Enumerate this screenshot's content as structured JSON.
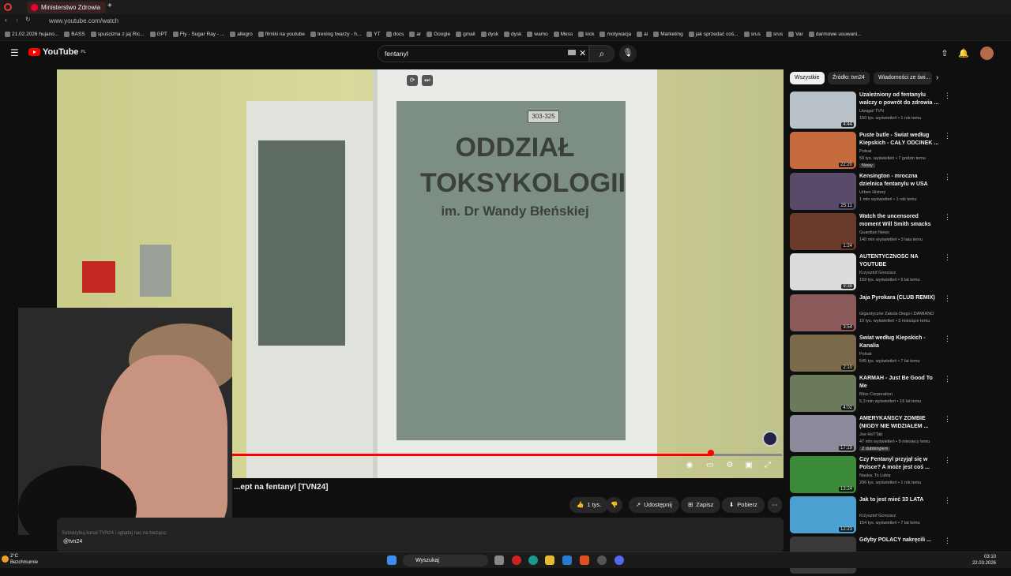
{
  "browser": {
    "tab_title": "Ministerstwo Zdrowia",
    "url": "www.youtube.com/watch"
  },
  "bookmarks": [
    "21.02.2026 hujano...",
    "BASS",
    "spuścizna z jaj Ric...",
    "GPT",
    "Fly - Sugar Ray - ...",
    "allegro",
    "filmiki na youtube",
    "trening twarzy - h...",
    "YT",
    "docs",
    "ar",
    "Google",
    "gmail",
    "dysk",
    "dysk",
    "wamo",
    "Mess",
    "kick",
    "motywacja",
    "ai",
    "Marketing",
    "jak sprzedać coś...",
    "srus",
    "srus",
    "Var",
    "darmowe usuwani..."
  ],
  "header": {
    "logo": "YouTube",
    "region": "PL",
    "search_value": "fentanyl"
  },
  "video": {
    "sign_room": "303-325",
    "sign_line1": "ODDZIAŁ",
    "sign_line2": "TOKSYKOLOGII",
    "sign_line3": "im. Dr Wandy Błeńskiej",
    "progress": 0.87,
    "title": "...ept na fentanyl [TVN24]"
  },
  "actions": {
    "likes": "1 tys.",
    "share": "Udostępnij",
    "save": "Zapisz",
    "download": "Pobierz"
  },
  "description": {
    "note": "Subskrybuj kanał TVN24 i oglądaj nas na bieżąco:",
    "channel": "@tvn24"
  },
  "chips": [
    "Wszystkie",
    "Źródło: tvn24",
    "Wiadomości ze świ..."
  ],
  "recommendations": [
    {
      "title": "Uzależniony od fentanylu walczy o powrót do zdrowia ...",
      "channel": "Uwaga! TVN",
      "meta": "150 tys. wyświetleń • 1 rok temu",
      "duration": "4:44",
      "color": "#b9c2c8",
      "badge": ""
    },
    {
      "title": "Puste butle - Świat według Kiepskich - CAŁY ODCINEK ...",
      "channel": "Polsat",
      "meta": "59 tys. wyświetleń • 7 godzin temu",
      "duration": "22:20",
      "color": "#c46a3c",
      "badge": "Nowy"
    },
    {
      "title": "Kensington - mroczna dzielnica fentanylu w USA",
      "channel": "Urbex History",
      "meta": "1 mln wyświetleń • 1 rok temu",
      "duration": "25:11",
      "color": "#5a4a6a",
      "badge": ""
    },
    {
      "title": "Watch the uncensored moment Will Smith smacks Chris Rock ...",
      "channel": "Guardian News",
      "meta": "140 mln wyświetleń • 3 lata temu",
      "duration": "1:24",
      "color": "#6a3a2a",
      "badge": ""
    },
    {
      "title": "AUTENTYCZNOŚĆ NA YOUTUBE",
      "channel": "Krzysztof Gonciarz",
      "meta": "159 tys. wyświetleń • 9 lat temu",
      "duration": "9:38",
      "color": "#dcdcdc",
      "badge": ""
    },
    {
      "title": "Jaja Pyrokara (CLUB REMIX)",
      "channel": "Gigantyczne Zakola Diego i DAMIANO",
      "meta": "10 tys. wyświetleń • 3 miesiące temu",
      "duration": "3:54",
      "color": "#8a5a5a",
      "badge": ""
    },
    {
      "title": "Świat według Kiepskich - Kanalia",
      "channel": "Polsat",
      "meta": "545 tys. wyświetleń • 7 lat temu",
      "duration": "2:10",
      "color": "#7a6a4a",
      "badge": ""
    },
    {
      "title": "KARMAH - Just Be Good To Me",
      "channel": "Bliss Corporation",
      "meta": "5,3 mln wyświetleń • 16 lat temu",
      "duration": "4:02",
      "color": "#6a7a5a",
      "badge": ""
    },
    {
      "title": "AMERYKAŃSCY ZOMBIE (NIGDY NIE WIDZIAŁEM ...",
      "channel": "Joe HsTTab",
      "meta": "47 mln wyświetleń • 9 miesięcy temu",
      "duration": "17:19",
      "color": "#8a8a9a",
      "badge": "Z dubbingiem"
    },
    {
      "title": "Czy Fentanyl przyjął się w Polsce? A może jest coś ...",
      "channel": "Nauka. To Lubię",
      "meta": "206 tys. wyświetleń • 1 rok temu",
      "duration": "13:24",
      "color": "#3a8a3a",
      "badge": ""
    },
    {
      "title": "Jak to jest mieć 33 LATA",
      "channel": "Krzysztof Gonciarz",
      "meta": "154 tys. wyświetleń • 7 lat temu",
      "duration": "12:23",
      "color": "#4aa0d0",
      "badge": ""
    },
    {
      "title": "Gdyby POLACY nakręcili ...",
      "channel": "",
      "meta": "",
      "duration": "",
      "color": "#3a3a3a",
      "badge": ""
    }
  ],
  "taskbar": {
    "temp": "2°C",
    "weather": "Bezchmurnie",
    "search": "Wyszukaj",
    "time": "03:10",
    "date": "22.03.2026"
  }
}
